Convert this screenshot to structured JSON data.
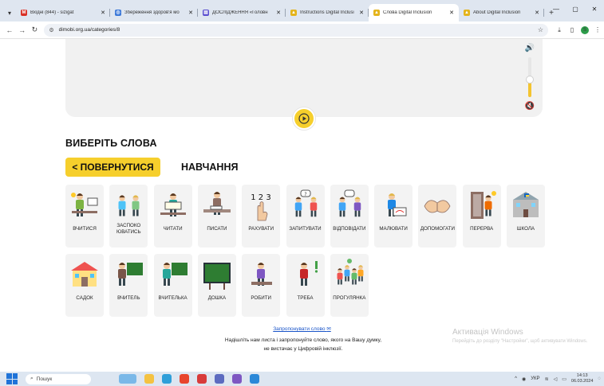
{
  "browser": {
    "tabs": [
      {
        "title": "Вхідні (844) - sizigat",
        "color": "#d93025",
        "icon": "M",
        "active": false
      },
      {
        "title": "Збереження здоров'я мо",
        "color": "#3c78d8",
        "icon": "◎",
        "active": false
      },
      {
        "title": "ДОСЛІДЖЕННЯ «Головн",
        "color": "#5a4fcf",
        "icon": "▤",
        "active": false
      },
      {
        "title": "Instructions Digital Inclusi",
        "color": "#e4b41c",
        "icon": "▲",
        "active": false
      },
      {
        "title": "Слова Digital Inclusion",
        "color": "#e4b41c",
        "icon": "▲",
        "active": true
      },
      {
        "title": "About Digital Inclusion",
        "color": "#e4b41c",
        "icon": "▲",
        "active": false
      }
    ],
    "url": "dimobi.org.ua/categories/8",
    "profile_initial": "S"
  },
  "page": {
    "section_title": "ВИБЕРІТЬ СЛОВА",
    "back_button": "< ПОВЕРНУТИСЯ",
    "category_name": "НАВЧАННЯ",
    "volume_level": 0.45,
    "words": [
      {
        "label": "ВЧИТИСЯ",
        "scene": "study"
      },
      {
        "label": "ЗАСПОКО ЮВАТИСЬ",
        "scene": "calm"
      },
      {
        "label": "ЧИТАТИ",
        "scene": "read"
      },
      {
        "label": "ПИСАТИ",
        "scene": "write"
      },
      {
        "label": "РАХУВАТИ",
        "scene": "count"
      },
      {
        "label": "ЗАПИТУВАТИ",
        "scene": "ask"
      },
      {
        "label": "ВІДПОВІДАТИ",
        "scene": "answer"
      },
      {
        "label": "МАЛЮВАТИ",
        "scene": "draw"
      },
      {
        "label": "ДОПОМОГАТИ",
        "scene": "help"
      },
      {
        "label": "ПЕРЕРВА",
        "scene": "break"
      },
      {
        "label": "ШКОЛА",
        "scene": "school"
      },
      {
        "label": "САДОК",
        "scene": "kindergarten"
      },
      {
        "label": "ВЧИТЕЛЬ",
        "scene": "teacher-m"
      },
      {
        "label": "ВЧИТЕЛЬКА",
        "scene": "teacher-f"
      },
      {
        "label": "ДОШКА",
        "scene": "board"
      },
      {
        "label": "РОБИТИ",
        "scene": "do"
      },
      {
        "label": "ТРЕБА",
        "scene": "need"
      },
      {
        "label": "ПРОГУЛЯНКА",
        "scene": "walk"
      }
    ],
    "count_digits": "1 2 3",
    "suggest_link": "Запропонувати слово",
    "suggest_text_1": "Надішліть нам листа і запропонуйте слово, якого на Вашу думку,",
    "suggest_text_2": "не вистачає у Цифровій інклюзії."
  },
  "watermark": {
    "title": "Активація Windows",
    "subtitle": "Перейдіть до розділу \"Настройки\", щоб активувати Windows."
  },
  "taskbar": {
    "search_label": "Пошук",
    "language": "УКР",
    "time": "14:13",
    "date": "06.03.2024"
  }
}
